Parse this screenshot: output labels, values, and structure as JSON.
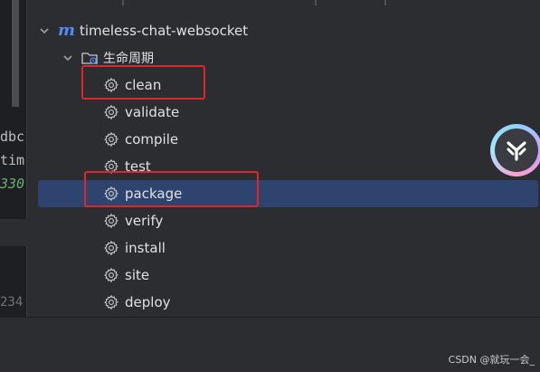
{
  "editor": {
    "code_lines": [
      "dbc",
      "tim",
      "330"
    ],
    "line_number": "234"
  },
  "tree": {
    "project": {
      "name": "timeless-chat-websocket",
      "icon": "maven-icon"
    },
    "lifecycle_folder": {
      "name": "生命周期",
      "icon": "folder-gear-icon"
    },
    "phases": [
      {
        "label": "clean"
      },
      {
        "label": "validate"
      },
      {
        "label": "compile"
      },
      {
        "label": "test"
      },
      {
        "label": "package"
      },
      {
        "label": "verify"
      },
      {
        "label": "install"
      },
      {
        "label": "site"
      },
      {
        "label": "deploy"
      }
    ],
    "selected_phase": "package"
  },
  "watermark": "CSDN @就玩一会_",
  "colors": {
    "background": "#2b2d30",
    "selection": "#2e436e",
    "highlight_box": "#e0262a",
    "maven_blue": "#548af7"
  }
}
